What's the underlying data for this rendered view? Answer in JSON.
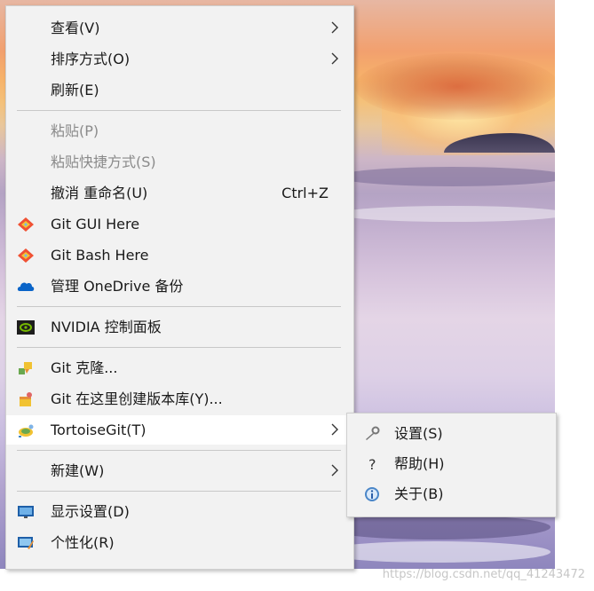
{
  "context_menu": {
    "items": [
      {
        "label": "查看(V)",
        "submenu": true
      },
      {
        "label": "排序方式(O)",
        "submenu": true
      },
      {
        "label": "刷新(E)"
      },
      {
        "label": "粘贴(P)",
        "disabled": true
      },
      {
        "label": "粘贴快捷方式(S)",
        "disabled": true
      },
      {
        "label": "撤消 重命名(U)",
        "shortcut": "Ctrl+Z"
      },
      {
        "label": "Git GUI Here",
        "icon": "git-gui-icon"
      },
      {
        "label": "Git Bash Here",
        "icon": "git-bash-icon"
      },
      {
        "label": "管理 OneDrive 备份",
        "icon": "onedrive-cloud-icon"
      },
      {
        "label": "NVIDIA 控制面板",
        "icon": "nvidia-icon"
      },
      {
        "label": "Git 克隆...",
        "icon": "tortoisegit-clone-icon"
      },
      {
        "label": "Git 在这里创建版本库(Y)...",
        "icon": "tortoisegit-create-repo-icon"
      },
      {
        "label": "TortoiseGit(T)",
        "icon": "tortoisegit-icon",
        "submenu": true,
        "highlighted": true
      },
      {
        "label": "新建(W)",
        "submenu": true
      },
      {
        "label": "显示设置(D)",
        "icon": "display-settings-icon"
      },
      {
        "label": "个性化(R)",
        "icon": "personalize-icon"
      }
    ]
  },
  "tortoisegit_submenu": {
    "items": [
      {
        "label": "设置(S)",
        "icon": "wrench-icon"
      },
      {
        "label": "帮助(H)",
        "icon": "help-icon"
      },
      {
        "label": "关于(B)",
        "icon": "info-icon"
      }
    ]
  },
  "watermark": "https://blog.csdn.net/qq_41243472",
  "colors": {
    "menu_bg": "#f2f2f2",
    "hover_bg": "#ffffff",
    "separator": "#c8c8c8",
    "disabled_text": "#8a8a8a"
  }
}
